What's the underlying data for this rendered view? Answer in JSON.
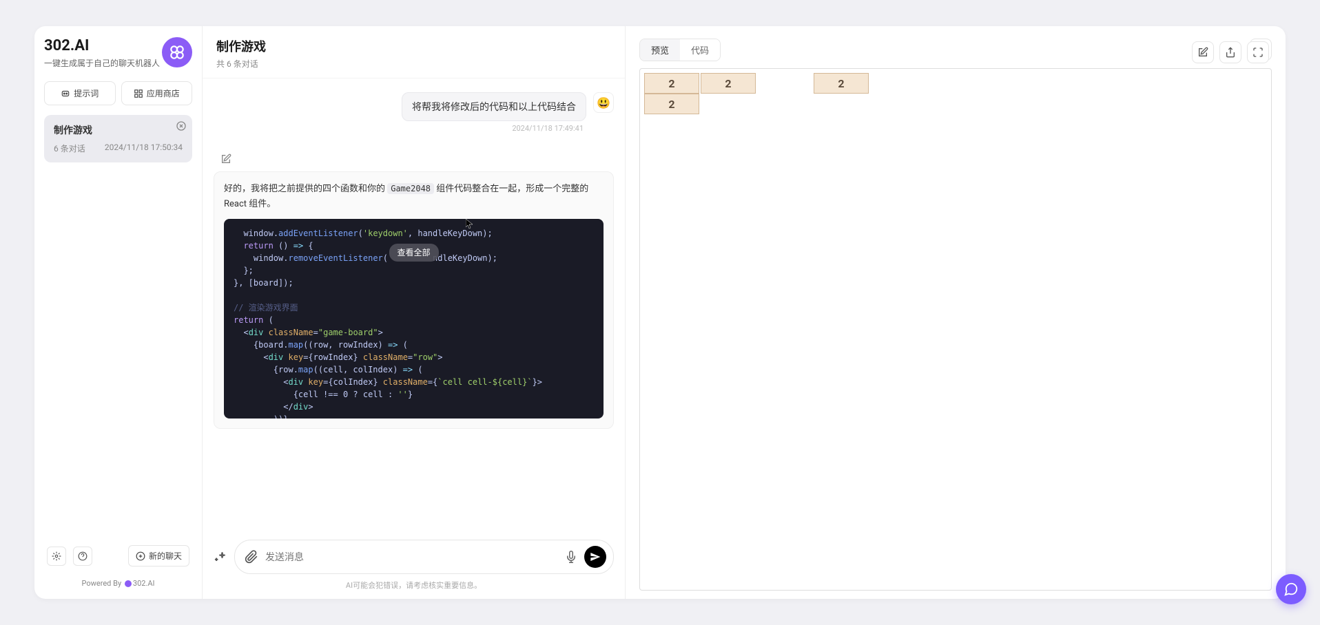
{
  "brand": {
    "title": "302.AI",
    "subtitle": "一键生成属于自己的聊天机器人"
  },
  "sidebar": {
    "prompts_label": "提示词",
    "apps_label": "应用商店",
    "new_chat_label": "新的聊天",
    "conversation": {
      "title": "制作游戏",
      "count": "6 条对话",
      "timestamp": "2024/11/18 17:50:34"
    },
    "powered_by_prefix": "Powered By",
    "powered_by_brand": "302.AI"
  },
  "chat": {
    "title": "制作游戏",
    "subtitle": "共 6 条对话",
    "user_message": "将帮我将修改后的代码和以上代码结合",
    "user_msg_time": "2024/11/18 17:49:41",
    "user_emoji": "😃",
    "ai_message_prefix": "好的，我将把之前提供的四个函数和你的 ",
    "ai_message_code_tag": "Game2048",
    "ai_message_suffix": " 组件代码整合在一起，形成一个完整的 React 组件。",
    "view_all_label": "查看全部",
    "input_placeholder": "发送消息",
    "disclaimer": "AI可能会犯错误，请考虑核实重要信息。"
  },
  "preview": {
    "tab_preview": "预览",
    "tab_code": "代码",
    "game_cells": [
      [
        "2",
        "2",
        "",
        "2"
      ],
      [
        "2"
      ]
    ]
  }
}
